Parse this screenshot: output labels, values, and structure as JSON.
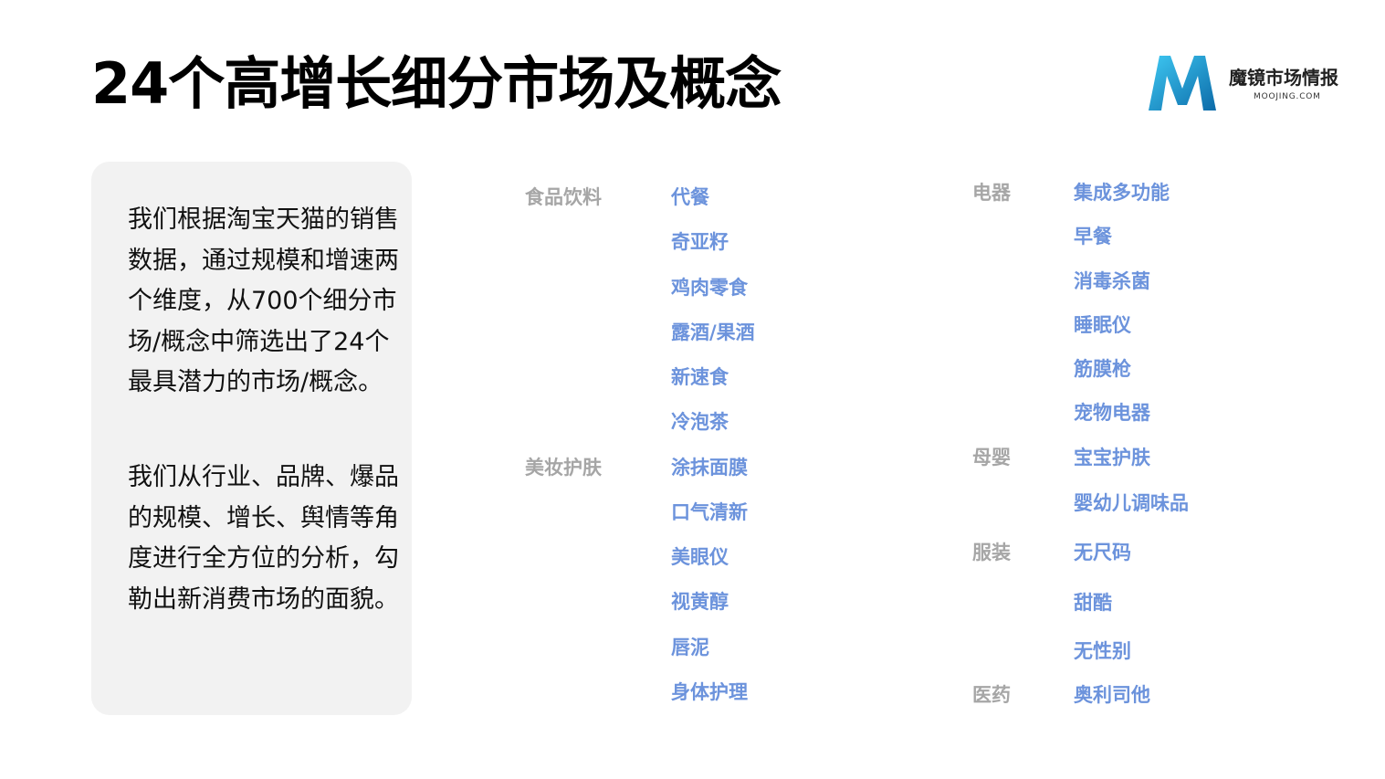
{
  "title": "24个高增长细分市场及概念",
  "brand": {
    "name_cn": "魔镜市场情报",
    "name_en": "MOOJING.COM",
    "logo_letter": "M",
    "logo_colors": [
      "#1e9fd8",
      "#3ec8f2",
      "#0c6aa8"
    ]
  },
  "intro": {
    "paragraph1": "我们根据淘宝天猫的销售数据，通过规模和增速两个维度，从700个细分市场/概念中筛选出了24个最具潜力的市场/概念。",
    "paragraph2": "我们从行业、品牌、爆品的规模、增长、舆情等角度进行全方位的分析，勾勒出新消费市场的面貌。"
  },
  "colors": {
    "category": "#a6a6a6",
    "item": "#6c93dc",
    "card_bg": "#f2f2f2"
  },
  "categories": {
    "food": {
      "name": "食品饮料",
      "items": [
        "代餐",
        "奇亚籽",
        "鸡肉零食",
        "露酒/果酒",
        "新速食",
        "冷泡茶"
      ]
    },
    "beauty": {
      "name": "美妆护肤",
      "items": [
        "涂抹面膜",
        "口气清新",
        "美眼仪",
        "视黄醇",
        "唇泥",
        "身体护理"
      ]
    },
    "appliance": {
      "name": "电器",
      "items": [
        "集成多功能",
        "早餐",
        "消毒杀菌",
        "睡眠仪",
        "筋膜枪",
        "宠物电器"
      ]
    },
    "baby": {
      "name": "母婴",
      "items": [
        "宝宝护肤",
        "婴幼儿调味品"
      ]
    },
    "apparel": {
      "name": "服装",
      "items": [
        "无尺码",
        "甜酷",
        "无性别"
      ]
    },
    "medicine": {
      "name": "医药",
      "items": [
        "奥利司他"
      ]
    }
  }
}
